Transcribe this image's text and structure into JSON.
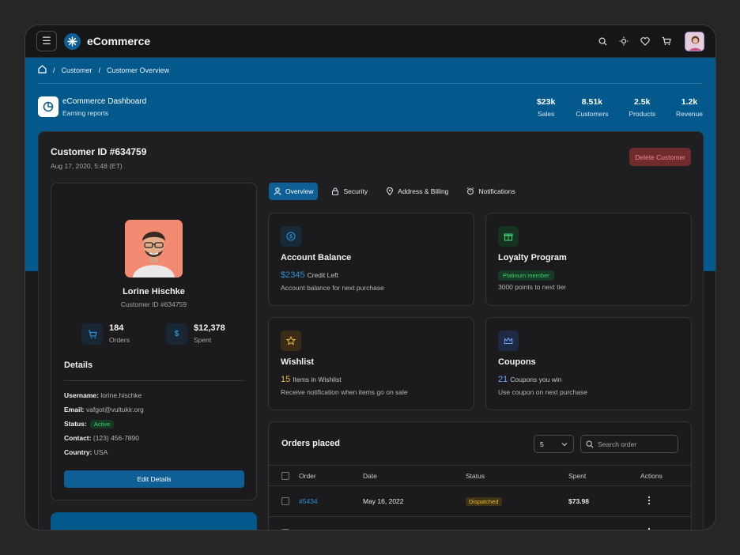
{
  "app": {
    "brand": "eCommerce"
  },
  "breadcrumb": {
    "items": [
      "Customer",
      "Customer Overview"
    ]
  },
  "dashboard": {
    "title": "eCommerce Dashboard",
    "subtitle": "Earning reports",
    "stats": [
      {
        "value": "$23k",
        "label": "Sales"
      },
      {
        "value": "8.51k",
        "label": "Customers"
      },
      {
        "value": "2.5k",
        "label": "Products"
      },
      {
        "value": "1.2k",
        "label": "Revenue"
      }
    ]
  },
  "customer": {
    "id_title": "Customer ID #634759",
    "date": "Aug 17, 2020, 5:48 (ET)",
    "delete_label": "Delete Customer",
    "name": "Lorine Hischke",
    "customer_id_line": "Customer ID #634759",
    "orders_count": "184",
    "orders_label": "Orders",
    "spent": "$12,378",
    "spent_label": "Spent",
    "details_heading": "Details",
    "username_label": "Username:",
    "username": "lorine.hischke",
    "email_label": "Email:",
    "email": "vafgot@vultukir.org",
    "status_label": "Status:",
    "status": "Active",
    "contact_label": "Contact:",
    "contact": "(123) 456-7890",
    "country_label": "Country:",
    "country": "USA",
    "edit_label": "Edit Details"
  },
  "tabs": [
    {
      "label": "Overview",
      "active": true
    },
    {
      "label": "Security"
    },
    {
      "label": "Address & Billing"
    },
    {
      "label": "Notifications"
    }
  ],
  "tiles": {
    "balance": {
      "title": "Account Balance",
      "amount": "$2345",
      "amount_text": "Credit Left",
      "desc": "Account balance for next purchase"
    },
    "loyalty": {
      "title": "Loyalty Program",
      "badge": "Platinum member",
      "desc": "3000 points to next tier"
    },
    "wishlist": {
      "title": "Wishlist",
      "count": "15",
      "count_text": "Items in Wishlist",
      "desc": "Receive notification when items go on sale"
    },
    "coupons": {
      "title": "Coupons",
      "count": "21",
      "count_text": "Coupons you win",
      "desc": "Use coupon on next purchase"
    }
  },
  "orders": {
    "title": "Orders placed",
    "page_size": "5",
    "search_placeholder": "Search order",
    "columns": [
      "Order",
      "Date",
      "Status",
      "Spent",
      "Actions"
    ],
    "rows": [
      {
        "order": "#5434",
        "date": "May 16, 2022",
        "status": "Dispatched",
        "spent": "$73.98"
      }
    ]
  },
  "colors": {
    "accent": "#0e5f95",
    "banner": "#03598b",
    "success": "#3fcf6e",
    "warning": "#e9b73d",
    "danger": "#f08888"
  }
}
